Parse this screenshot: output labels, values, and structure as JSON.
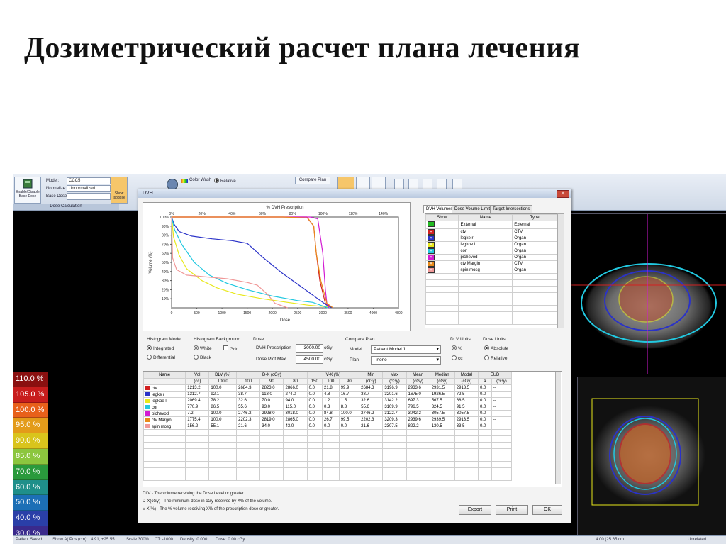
{
  "slide_title": "Дозиметрический расчет плана лечения",
  "ribbon": {
    "enable_base_dose": "Enable/Disable Base Dose",
    "model_label": "Model:",
    "model_value": "CCC5",
    "normalize_label": "Normalize:",
    "normalize_value": "Unnormalized",
    "base_dose_label": "Base Dose:",
    "show_isodose": "Show Isodose",
    "color_wash": "Color Wash",
    "relative": "Relative",
    "compare_plan": "Compare Plan",
    "group_label": "Dose Calculation"
  },
  "isodose_legend": [
    {
      "label": "110.0 %",
      "color": "#8a1010"
    },
    {
      "label": "105.0 %",
      "color": "#c81d1d"
    },
    {
      "label": "100.0 %",
      "color": "#e8601a"
    },
    {
      "label": "95.0 %",
      "color": "#e39b1a"
    },
    {
      "label": "90.0 %",
      "color": "#d9c41c"
    },
    {
      "label": "85.0 %",
      "color": "#8cc63e"
    },
    {
      "label": "70.0 %",
      "color": "#2a9a3c"
    },
    {
      "label": "60.0 %",
      "color": "#1f8f8a"
    },
    {
      "label": "50.0 %",
      "color": "#1c6fb6"
    },
    {
      "label": "40.0 %",
      "color": "#2a3fa8"
    },
    {
      "label": "30.0 %",
      "color": "#3a2a8c"
    }
  ],
  "status": {
    "saved": "Patient Saved",
    "show": "Show A(",
    "pos": "Pos (cm):",
    "coords": "4.91, +25.55",
    "scale": "Scale 300%",
    "ct": "CT: -1000",
    "density": "Density: 0.000",
    "dose": "Dose: 0.00 cGy",
    "zoom": "4.00 (25.65 cm",
    "unrelated": "Unrelated"
  },
  "dvh_window": {
    "title": "DVH",
    "close": "X",
    "chart_top_title": "% DVH Prescription",
    "tabs": [
      "DVH Volumes",
      "Dose Volume Limits",
      "Target Intersections"
    ],
    "vol_headers": [
      "Show",
      "Name",
      "Type"
    ],
    "volumes": [
      {
        "name": "External",
        "type": "External",
        "color": "#22bb22"
      },
      {
        "name": "ctv",
        "type": "CTV",
        "color": "#d22020"
      },
      {
        "name": "legke r",
        "type": "Organ",
        "color": "#2a32c8"
      },
      {
        "name": "legkoe l",
        "type": "Organ",
        "color": "#e8e81a"
      },
      {
        "name": "cor",
        "type": "Organ",
        "color": "#22c8e0"
      },
      {
        "name": "pichevod",
        "type": "Organ",
        "color": "#d21ad2"
      },
      {
        "name": "ctv Margin",
        "type": "CTV",
        "color": "#e88a1a"
      },
      {
        "name": "spin mosg",
        "type": "Organ",
        "color": "#f09898"
      }
    ],
    "histogram_mode": {
      "label": "Histogram Mode",
      "options": [
        "Integrated",
        "Differential"
      ],
      "selected": "Integrated"
    },
    "histogram_bg": {
      "label": "Histogram Background",
      "options": [
        "White",
        "Black"
      ],
      "grid": "Grid",
      "selected": "White"
    },
    "dose": {
      "label": "Dose",
      "prescription_label": "DVH Prescription",
      "prescription": "3000.00",
      "plot_max_label": "Dose Plot Max",
      "plot_max": "4500.00",
      "unit": "cGy"
    },
    "compare_plan": {
      "label": "Compare Plan",
      "model_label": "Model",
      "model": "Patient Model 1",
      "plan_label": "Plan",
      "plan": "--none--"
    },
    "dlv_units": {
      "label": "DLV Units",
      "options": [
        "%",
        "cc"
      ],
      "selected": "%"
    },
    "dose_units": {
      "label": "Dose Units",
      "options": [
        "Absolute",
        "Relative"
      ],
      "selected": "Absolute"
    },
    "stats_headers": [
      "Name",
      "Vol",
      "DLV (%)",
      "D-X (cGy)",
      "V-X (%)",
      "Min",
      "Max",
      "Mean",
      "Median",
      "Modal",
      "EUD"
    ],
    "stats_subheaders": [
      "",
      "(cc)",
      "100.0",
      "100",
      "90",
      "80",
      "150",
      "100",
      "90",
      "(cGy)",
      "(cGy)",
      "(cGy)",
      "(cGy)",
      "(cGy)",
      "a",
      "(cGy)"
    ],
    "stats_rows": [
      {
        "color": "#d22020",
        "cells": [
          "ctv",
          "1213.2",
          "100.0",
          "2684.3",
          "2823.0",
          "2866.0",
          "0.0",
          "21.8",
          "99.9",
          "2684.3",
          "3196.9",
          "2933.6",
          "2931.5",
          "2913.5",
          "0.0",
          "--"
        ]
      },
      {
        "color": "#2a32c8",
        "cells": [
          "legke r",
          "1312.7",
          "92.1",
          "38.7",
          "118.0",
          "274.0",
          "0.0",
          "4.8",
          "16.7",
          "38.7",
          "3201.6",
          "1675.0",
          "1926.5",
          "72.5",
          "0.0",
          "--"
        ]
      },
      {
        "color": "#e8e81a",
        "cells": [
          "legkoe l",
          "2069.4",
          "78.2",
          "32.6",
          "70.0",
          "94.0",
          "0.0",
          "1.2",
          "1.5",
          "32.6",
          "3142.2",
          "697.3",
          "567.5",
          "68.5",
          "0.0",
          "--"
        ]
      },
      {
        "color": "#22c8e0",
        "cells": [
          "cor",
          "770.9",
          "86.5",
          "55.6",
          "93.0",
          "115.0",
          "0.0",
          "0.3",
          "8.8",
          "55.6",
          "3109.9",
          "796.5",
          "324.5",
          "91.5",
          "0.0",
          "--"
        ]
      },
      {
        "color": "#d21ad2",
        "cells": [
          "pichevod",
          "7.2",
          "100.0",
          "2746.2",
          "2928.0",
          "3018.0",
          "0.0",
          "84.8",
          "100.0",
          "2746.2",
          "3122.7",
          "3042.2",
          "3057.5",
          "3057.5",
          "0.0",
          "--"
        ]
      },
      {
        "color": "#e88a1a",
        "cells": [
          "ctv Margin",
          "1775.4",
          "100.0",
          "2202.3",
          "2819.0",
          "2865.0",
          "0.0",
          "26.7",
          "99.5",
          "2202.3",
          "3209.3",
          "2939.6",
          "2939.5",
          "2913.5",
          "0.0",
          "--"
        ]
      },
      {
        "color": "#f09898",
        "cells": [
          "spin mosg",
          "156.2",
          "55.1",
          "21.6",
          "34.0",
          "43.0",
          "0.0",
          "0.0",
          "0.0",
          "21.6",
          "2307.5",
          "822.2",
          "130.5",
          "33.5",
          "0.0",
          "--"
        ]
      }
    ],
    "notes": [
      "DLV - The volume receiving the Dose Level or greater.",
      "D-X(cGy) - The minimum dose in cGy received by X% of the volume.",
      "V-X(%) - The % volume receiving X% of the prescription dose or greater."
    ],
    "buttons": {
      "export": "Export",
      "print": "Print",
      "ok": "OK"
    }
  },
  "chart_data": {
    "type": "line",
    "title": "% DVH Prescription",
    "xlabel": "Dose",
    "ylabel": "Volume (%)",
    "xlim": [
      0,
      4500
    ],
    "ylim": [
      0,
      100
    ],
    "x_ticks": [
      "0",
      "500",
      "1000",
      "1500",
      "2000",
      "2500",
      "3000",
      "3500",
      "4000",
      "4500"
    ],
    "y_ticks": [
      "10%",
      "20%",
      "30%",
      "40%",
      "50%",
      "60%",
      "70%",
      "80%",
      "90%",
      "100%"
    ],
    "top_ticks": [
      "0%",
      "20%",
      "40%",
      "60%",
      "80%",
      "100%",
      "120%",
      "140%"
    ],
    "series": [
      {
        "name": "ctv",
        "color": "#d22020",
        "points": [
          [
            0,
            100
          ],
          [
            2680,
            100
          ],
          [
            2820,
            90
          ],
          [
            2870,
            60
          ],
          [
            2940,
            30
          ],
          [
            3050,
            5
          ],
          [
            3200,
            0
          ]
        ]
      },
      {
        "name": "legke r",
        "color": "#2a32c8",
        "points": [
          [
            0,
            100
          ],
          [
            50,
            92
          ],
          [
            150,
            84
          ],
          [
            400,
            79
          ],
          [
            800,
            76
          ],
          [
            1200,
            74
          ],
          [
            1500,
            71
          ],
          [
            1800,
            56
          ],
          [
            2200,
            38
          ],
          [
            2600,
            22
          ],
          [
            2900,
            10
          ],
          [
            3100,
            2
          ],
          [
            3200,
            0
          ]
        ]
      },
      {
        "name": "legkoe l",
        "color": "#e8e81a",
        "points": [
          [
            0,
            100
          ],
          [
            40,
            78
          ],
          [
            150,
            58
          ],
          [
            300,
            43
          ],
          [
            600,
            30
          ],
          [
            900,
            22
          ],
          [
            1300,
            15
          ],
          [
            1800,
            10
          ],
          [
            2300,
            6
          ],
          [
            2700,
            3
          ],
          [
            3100,
            1
          ]
        ]
      },
      {
        "name": "cor",
        "color": "#22c8e0",
        "points": [
          [
            0,
            100
          ],
          [
            60,
            86
          ],
          [
            200,
            70
          ],
          [
            450,
            50
          ],
          [
            750,
            36
          ],
          [
            1100,
            27
          ],
          [
            1500,
            20
          ],
          [
            2000,
            13
          ],
          [
            2500,
            8
          ],
          [
            2800,
            6
          ],
          [
            3000,
            2
          ],
          [
            3100,
            0
          ]
        ]
      },
      {
        "name": "pichevod",
        "color": "#d21ad2",
        "points": [
          [
            0,
            100
          ],
          [
            2746,
            100
          ],
          [
            2900,
            98
          ],
          [
            3000,
            60
          ],
          [
            3050,
            20
          ],
          [
            3080,
            5
          ],
          [
            3120,
            0
          ]
        ]
      },
      {
        "name": "ctv Margin",
        "color": "#e88a1a",
        "points": [
          [
            0,
            100
          ],
          [
            2200,
            100
          ],
          [
            2700,
            99
          ],
          [
            2820,
            90
          ],
          [
            2870,
            60
          ],
          [
            2960,
            30
          ],
          [
            3080,
            5
          ],
          [
            3200,
            0
          ]
        ]
      },
      {
        "name": "spin mosg",
        "color": "#f09898",
        "points": [
          [
            0,
            100
          ],
          [
            20,
            55
          ],
          [
            100,
            42
          ],
          [
            300,
            36
          ],
          [
            700,
            34
          ],
          [
            1100,
            32
          ],
          [
            1500,
            28
          ],
          [
            1700,
            25
          ],
          [
            1900,
            15
          ],
          [
            2050,
            5
          ],
          [
            2300,
            0
          ]
        ]
      }
    ]
  }
}
